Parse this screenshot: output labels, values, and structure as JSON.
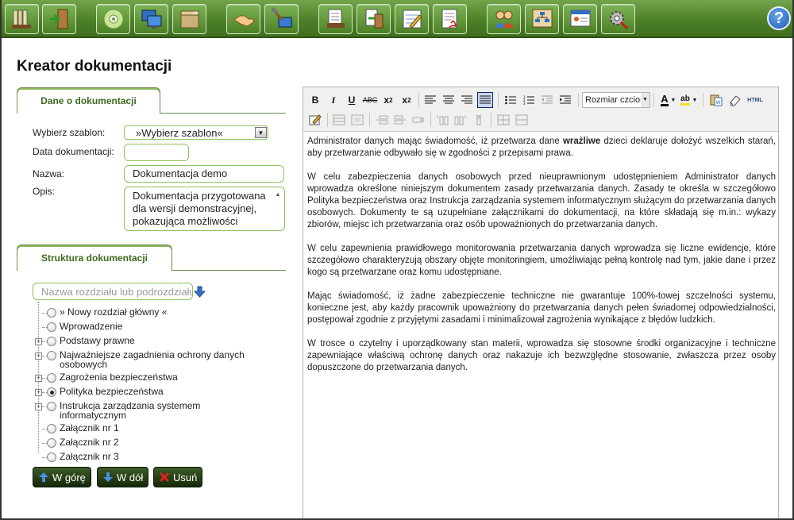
{
  "toolbar": {
    "buttons": [
      {
        "icon": "binders-icon"
      },
      {
        "icon": "exit-door-icon"
      },
      {
        "icon": "cd-disc-icon"
      },
      {
        "icon": "monitors-icon"
      },
      {
        "icon": "zip-archive-icon"
      },
      {
        "icon": "handshake-icon"
      },
      {
        "icon": "tools-icon"
      },
      {
        "icon": "documents-icon"
      },
      {
        "icon": "document-exit-icon"
      },
      {
        "icon": "edit-form-icon"
      },
      {
        "icon": "pdf-document-icon"
      },
      {
        "icon": "users-icon"
      },
      {
        "icon": "org-chart-icon"
      },
      {
        "icon": "id-card-icon"
      },
      {
        "icon": "settings-gear-icon"
      }
    ],
    "help_label": "?"
  },
  "page": {
    "title": "Kreator dokumentacji"
  },
  "tabs": {
    "doc_info": "Dane o dokumentacji",
    "structure": "Struktura dokumentacji"
  },
  "form": {
    "template_label": "Wybierz szablon:",
    "template_value": "»Wybierz szablon«",
    "date_label": "Data dokumentacji:",
    "date_value": "",
    "name_label": "Nazwa:",
    "name_value": "Dokumentacja demo",
    "desc_label": "Opis:",
    "desc_value": "Dokumentacja przygotowana dla wersji demonstracyjnej, pokazująca możliwości"
  },
  "tree": {
    "search_placeholder": "Nazwa rozdziału lub podrozdziału",
    "items": [
      {
        "label": "» Nowy rozdział główny «",
        "expandable": false,
        "selected": false
      },
      {
        "label": "Wprowadzenie",
        "expandable": false,
        "selected": false
      },
      {
        "label": "Podstawy prawne",
        "expandable": true,
        "selected": false
      },
      {
        "label": "Najważniejsze zagadnienia ochrony danych osobowych",
        "expandable": true,
        "selected": false
      },
      {
        "label": "Zagrożenia bezpieczeństwa",
        "expandable": true,
        "selected": false
      },
      {
        "label": "Polityka bezpieczeństwa",
        "expandable": true,
        "selected": true
      },
      {
        "label": "Instrukcja zarządzania systemem informatycznym",
        "expandable": true,
        "selected": false
      },
      {
        "label": "Załącznik nr 1",
        "expandable": false,
        "selected": false
      },
      {
        "label": "Załącznik nr 2",
        "expandable": false,
        "selected": false
      },
      {
        "label": "Załącznik nr 3",
        "expandable": false,
        "selected": false
      }
    ]
  },
  "buttons": {
    "up": "W górę",
    "down": "W dół",
    "delete": "Usuń"
  },
  "editor": {
    "font_size_label": "Rozmiar czcionki",
    "html_label": "HTML",
    "paragraphs": [
      {
        "before": "Administrator danych mając świadomość, iż przetwarza dane ",
        "bold": "wrażliwe",
        "after": " dzieci deklaruje dołożyć wszelkich starań, aby przetwarzanie odbywało się w zgodności z przepisami prawa."
      },
      {
        "before": "W celu zabezpieczenia danych osobowych przed nieuprawnionym udostępnieniem Administrator danych wprowadza określone niniejszym dokumentem zasady przetwarzania danych. Zasady te określa w szczegółowo Polityka bezpieczeństwa oraz Instrukcja zarządzania systemem informatycznym służącym do przetwarzania danych osobowych. Dokumenty te są uzupełniane załącznikami do dokumentacji, na które składają się m.in.: wykazy zbiorów, miejsc ich przetwarzania oraz osób upoważnionych do przetwarzania danych.",
        "bold": "",
        "after": ""
      },
      {
        "before": "W celu zapewnienia prawidłowego monitorowania przetwarzania danych wprowadza się liczne ewidencje, które szczegółowo charakteryzują obszary objęte monitoringiem, umożliwiając pełną kontrolę nad tym, jakie dane i przez kogo są przetwarzane oraz komu udostępniane.",
        "bold": "",
        "after": ""
      },
      {
        "before": "Mając świadomość, iż żadne zabezpieczenie techniczne nie gwarantuje 100%-towej szczelności systemu, konieczne jest, aby każdy pracownik upoważniony do przetwarzania danych pełen świadomej odpowiedzialności, postępował zgodnie z przyjętymi zasadami i minimalizował zagrożenia wynikające z błędów ludzkich.",
        "bold": "",
        "after": ""
      },
      {
        "before": "W trosce o czytelny i uporządkowany stan materii, wprowadza się stosowne środki organizacyjne i techniczne zapewniające właściwą ochronę danych oraz nakazuje ich bezwzględne stosowanie, zwłaszcza przez osoby dopuszczone do przetwarzania danych.",
        "bold": "",
        "after": ""
      }
    ]
  },
  "colors": {
    "toolbar_green": "#4d8028",
    "tab_green": "#3d6a1d",
    "field_border": "#8fc05f",
    "button_dark": "#1f3410"
  }
}
